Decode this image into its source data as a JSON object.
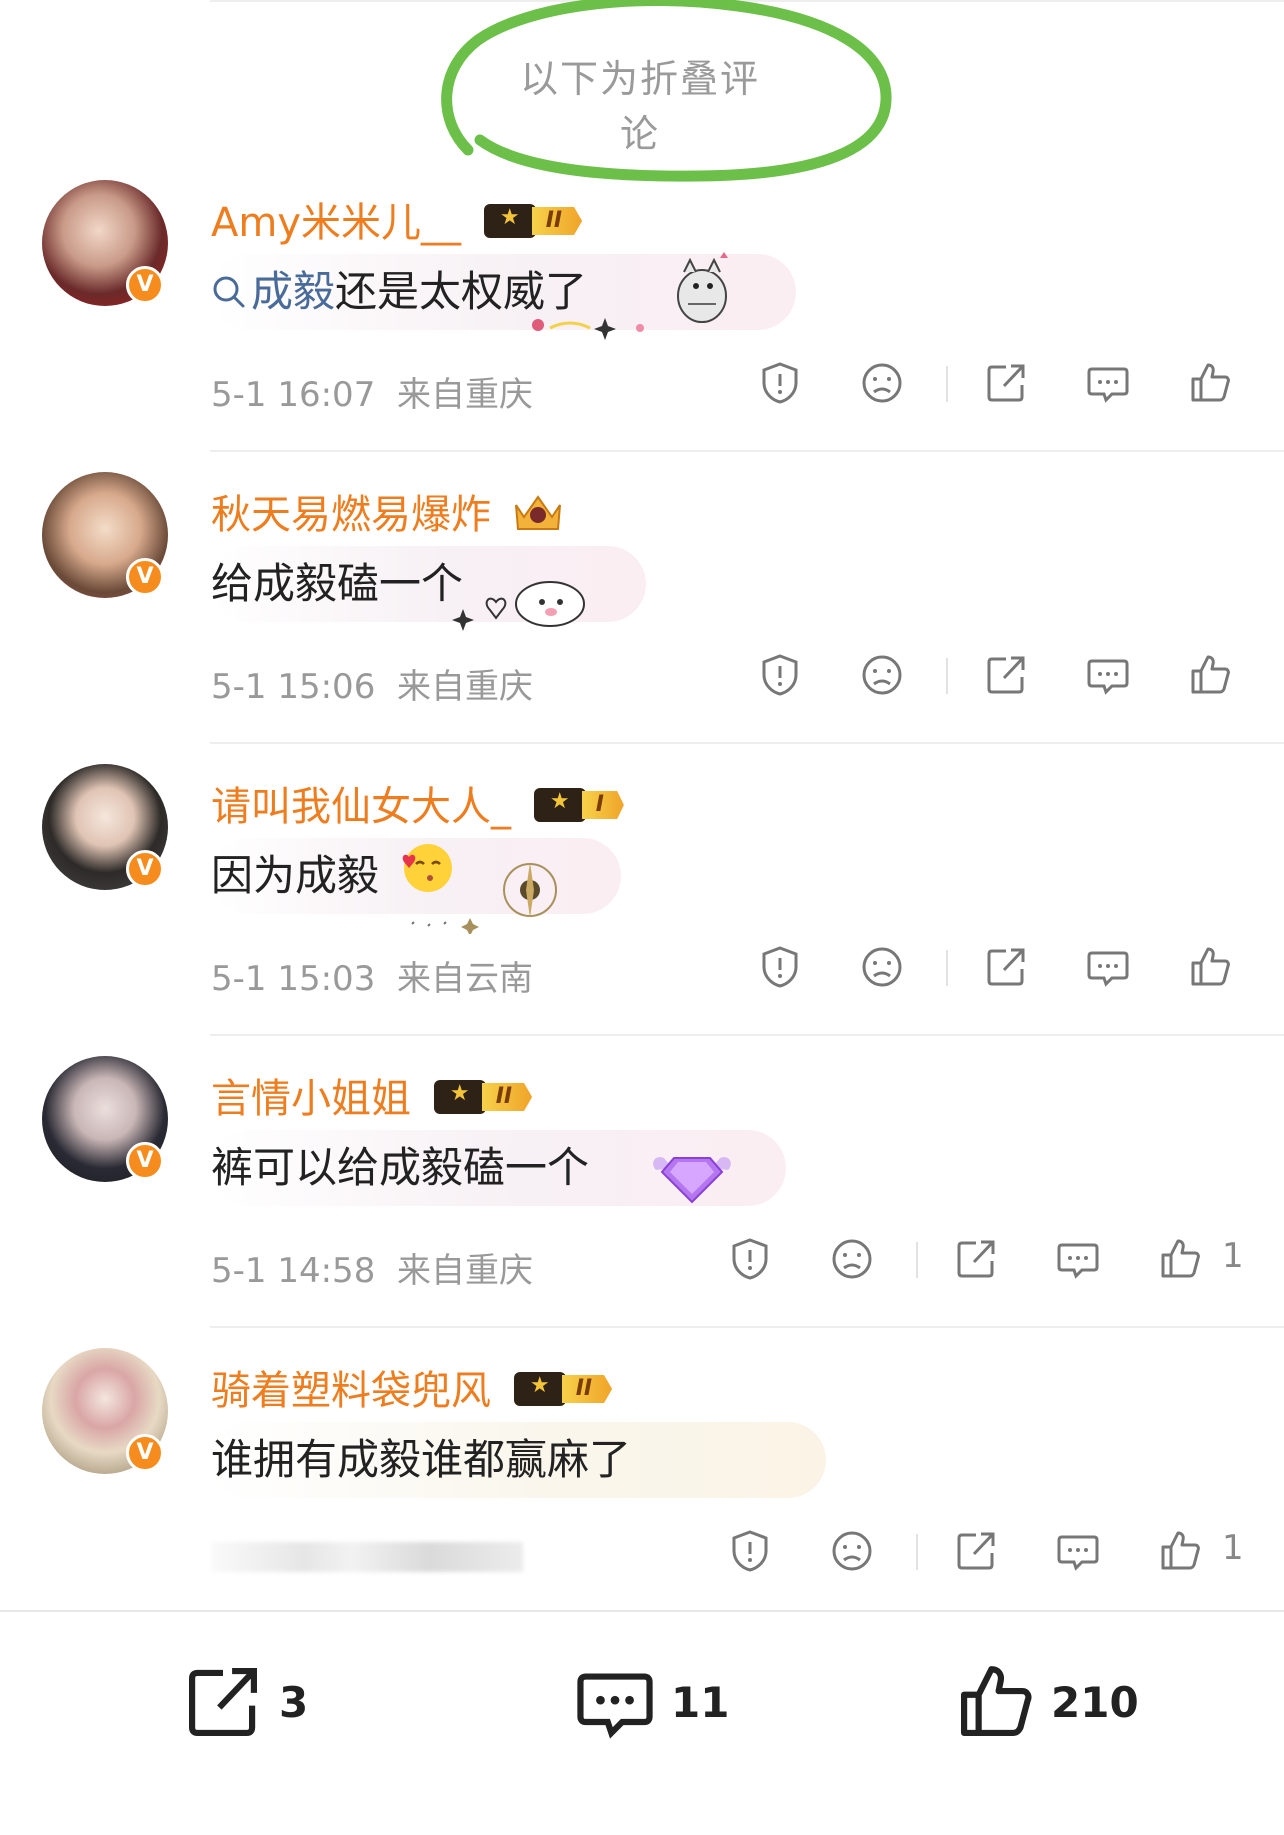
{
  "folded_label": "以下为折叠评论",
  "comments": [
    {
      "username": "Amy米米儿__",
      "vip_level": "II",
      "text_prefix": "成毅",
      "text": "还是太权威了",
      "timestamp": "5-1 16:07",
      "location": "来自重庆",
      "likes": ""
    },
    {
      "username": "秋天易燃易爆炸",
      "vip_level": "",
      "text_prefix": "",
      "text": "给成毅磕一个",
      "timestamp": "5-1 15:06",
      "location": "来自重庆",
      "likes": ""
    },
    {
      "username": "请叫我仙女大人_",
      "vip_level": "I",
      "text_prefix": "",
      "text": "因为成毅",
      "timestamp": "5-1 15:03",
      "location": "来自云南",
      "likes": ""
    },
    {
      "username": "言情小姐姐",
      "vip_level": "II",
      "text_prefix": "",
      "text": "裤可以给成毅磕一个",
      "timestamp": "5-1 14:58",
      "location": "来自重庆",
      "likes": "1"
    },
    {
      "username": "骑着塑料袋兜风",
      "vip_level": "II",
      "text_prefix": "",
      "text": "谁拥有成毅谁都赢麻了",
      "timestamp": "",
      "location": "",
      "likes": "1"
    }
  ],
  "bottom_bar": {
    "share_count": "3",
    "comment_count": "11",
    "like_count": "210"
  },
  "colors": {
    "username": "#ee7d1f",
    "verified_badge": "#f78c1e",
    "annotation_circle": "#6cc04a",
    "link": "#4a6b9a"
  },
  "icons": [
    "report-icon",
    "dislike-icon",
    "share-icon",
    "comment-icon",
    "like-icon",
    "search-icon"
  ]
}
